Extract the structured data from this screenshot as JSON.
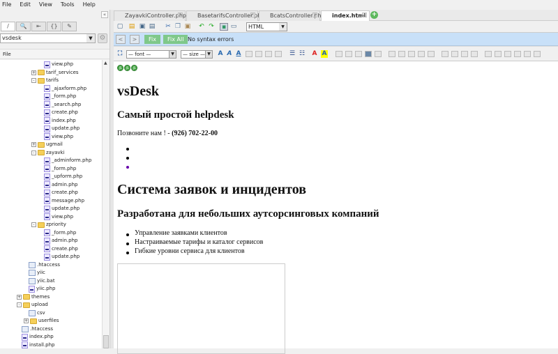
{
  "menu": [
    "File",
    "Edit",
    "View",
    "Tools",
    "Help"
  ],
  "left": {
    "collapse": "«",
    "tabs": [
      "/",
      "🔍",
      "⇤",
      "{}",
      "✎"
    ],
    "project": "vsdesk",
    "file_header": "File"
  },
  "tree": [
    {
      "l": "view.php",
      "t": "php",
      "x": 63
    },
    {
      "l": "tarif_services",
      "t": "folder",
      "x": 45,
      "e": "+"
    },
    {
      "l": "tarifs",
      "t": "folder",
      "x": 45,
      "e": "−"
    },
    {
      "l": "_ajaxform.php",
      "t": "php",
      "x": 63
    },
    {
      "l": "_form.php",
      "t": "php",
      "x": 63
    },
    {
      "l": "_search.php",
      "t": "php",
      "x": 63
    },
    {
      "l": "create.php",
      "t": "php",
      "x": 63
    },
    {
      "l": "index.php",
      "t": "php",
      "x": 63
    },
    {
      "l": "update.php",
      "t": "php",
      "x": 63
    },
    {
      "l": "view.php",
      "t": "php",
      "x": 63
    },
    {
      "l": "ugmail",
      "t": "folder",
      "x": 45,
      "e": "+"
    },
    {
      "l": "zayavki",
      "t": "folder",
      "x": 45,
      "e": "−"
    },
    {
      "l": "_adminform.php",
      "t": "php",
      "x": 63
    },
    {
      "l": "_form.php",
      "t": "php",
      "x": 63
    },
    {
      "l": "_upform.php",
      "t": "php",
      "x": 63
    },
    {
      "l": "admin.php",
      "t": "php",
      "x": 63
    },
    {
      "l": "create.php",
      "t": "php",
      "x": 63
    },
    {
      "l": "message.php",
      "t": "php",
      "x": 63
    },
    {
      "l": "update.php",
      "t": "php",
      "x": 63
    },
    {
      "l": "view.php",
      "t": "php",
      "x": 63
    },
    {
      "l": "zpriority",
      "t": "folder",
      "x": 45,
      "e": "−"
    },
    {
      "l": "_form.php",
      "t": "php",
      "x": 63
    },
    {
      "l": "admin.php",
      "t": "php",
      "x": 63
    },
    {
      "l": "create.php",
      "t": "php",
      "x": 63
    },
    {
      "l": "update.php",
      "t": "php",
      "x": 63
    },
    {
      "l": ".htaccess",
      "t": "txt",
      "x": 41
    },
    {
      "l": "yiic",
      "t": "txt",
      "x": 41
    },
    {
      "l": "yiic.bat",
      "t": "txt",
      "x": 41
    },
    {
      "l": "yiic.php",
      "t": "php",
      "x": 41
    },
    {
      "l": "themes",
      "t": "folder",
      "x": 24,
      "e": "+"
    },
    {
      "l": "upload",
      "t": "folder",
      "x": 24,
      "e": "−"
    },
    {
      "l": "csv",
      "t": "txt",
      "x": 41
    },
    {
      "l": "userfiles",
      "t": "folder",
      "x": 34,
      "e": "+"
    },
    {
      "l": ".htaccess",
      "t": "txt",
      "x": 31
    },
    {
      "l": "index.php",
      "t": "php",
      "x": 31
    },
    {
      "l": "install.php",
      "t": "php",
      "x": 31
    }
  ],
  "tabs": [
    {
      "label": "ZayavkiController.php*"
    },
    {
      "label": "BasetarifsController.php"
    },
    {
      "label": "BcatsController.php"
    },
    {
      "label": "index.html",
      "active": true
    }
  ],
  "toolbar": {
    "mode": "HTML"
  },
  "syntax": {
    "prev": "<",
    "next": ">",
    "fix": "Fix",
    "fix_all": "Fix All",
    "message": "No syntax errors"
  },
  "format": {
    "font": "— font —",
    "size": "— size —"
  },
  "page": {
    "badges": [
      "JS",
      "JS",
      "JS"
    ],
    "title": "vsDesk",
    "subtitle": "Самый простой helpdesk",
    "call_text": "Позвоните нам ! - ",
    "phone": "(926) 702-22-00",
    "h1b": "Система заявок и инцидентов",
    "h2b": "Разработана для небольших аутсорсинговых компаний",
    "features": [
      "Управление заявками клиентов",
      "Настраиваемые тарифы и каталог сервисов",
      "Гибкие уровни сервиса для клиентов"
    ]
  }
}
